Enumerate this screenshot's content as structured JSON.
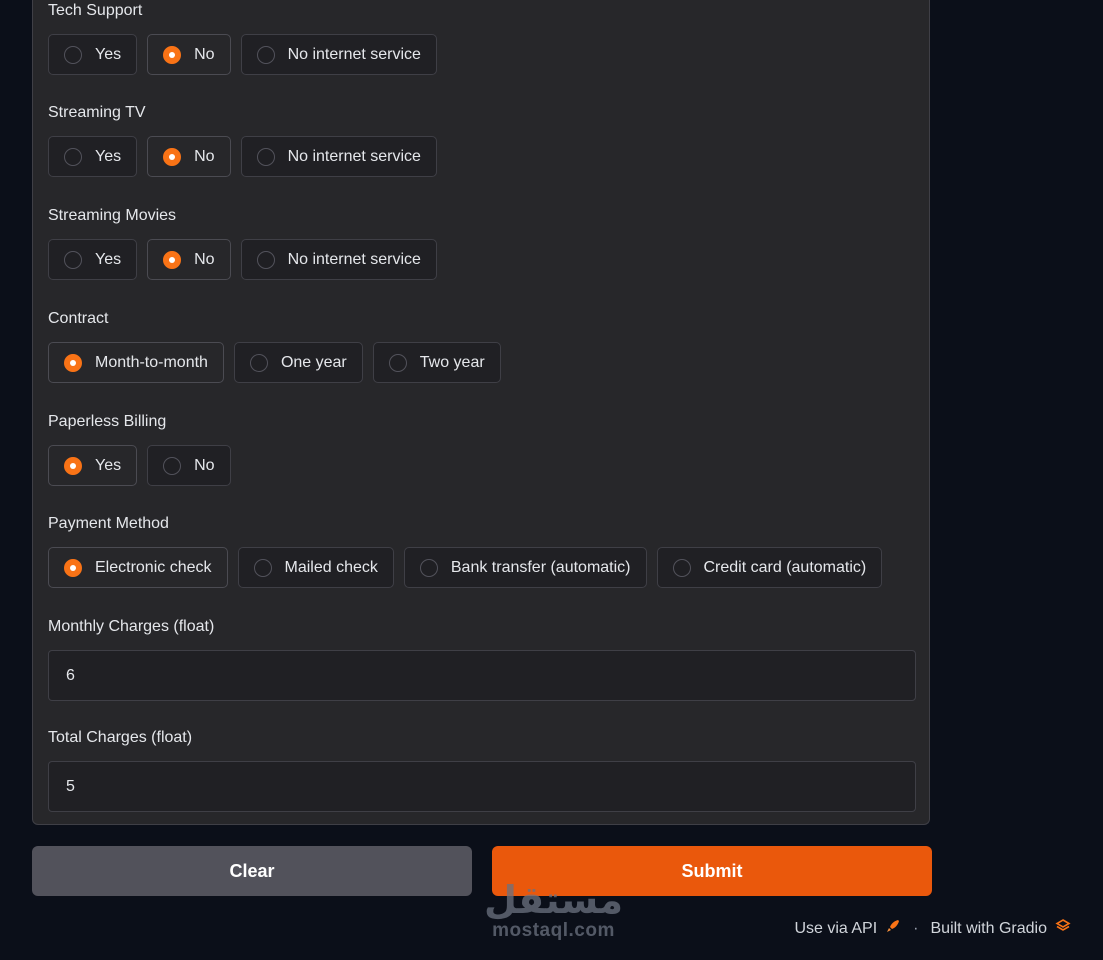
{
  "fields": {
    "tech_support": {
      "label": "Tech Support",
      "options": [
        "Yes",
        "No",
        "No internet service"
      ],
      "selected": "No"
    },
    "streaming_tv": {
      "label": "Streaming TV",
      "options": [
        "Yes",
        "No",
        "No internet service"
      ],
      "selected": "No"
    },
    "streaming_movies": {
      "label": "Streaming Movies",
      "options": [
        "Yes",
        "No",
        "No internet service"
      ],
      "selected": "No"
    },
    "contract": {
      "label": "Contract",
      "options": [
        "Month-to-month",
        "One year",
        "Two year"
      ],
      "selected": "Month-to-month"
    },
    "paperless_billing": {
      "label": "Paperless Billing",
      "options": [
        "Yes",
        "No"
      ],
      "selected": "Yes"
    },
    "payment_method": {
      "label": "Payment Method",
      "options": [
        "Electronic check",
        "Mailed check",
        "Bank transfer (automatic)",
        "Credit card (automatic)"
      ],
      "selected": "Electronic check"
    },
    "monthly_charges": {
      "label": "Monthly Charges (float)",
      "value": "6"
    },
    "total_charges": {
      "label": "Total Charges (float)",
      "value": "5"
    }
  },
  "buttons": {
    "clear": "Clear",
    "submit": "Submit"
  },
  "footer": {
    "api": "Use via API",
    "separator": "·",
    "built": "Built with Gradio",
    "api_icon": "rocket-icon",
    "gradio_icon": "gradio-logo-icon"
  },
  "watermark": {
    "arabic": "مستقل",
    "latin": "mostaql.com"
  },
  "colors": {
    "accent": "#f97316",
    "submit": "#ea580c",
    "clear": "#52525b",
    "panel": "#27272a",
    "background": "#0b0f19"
  }
}
